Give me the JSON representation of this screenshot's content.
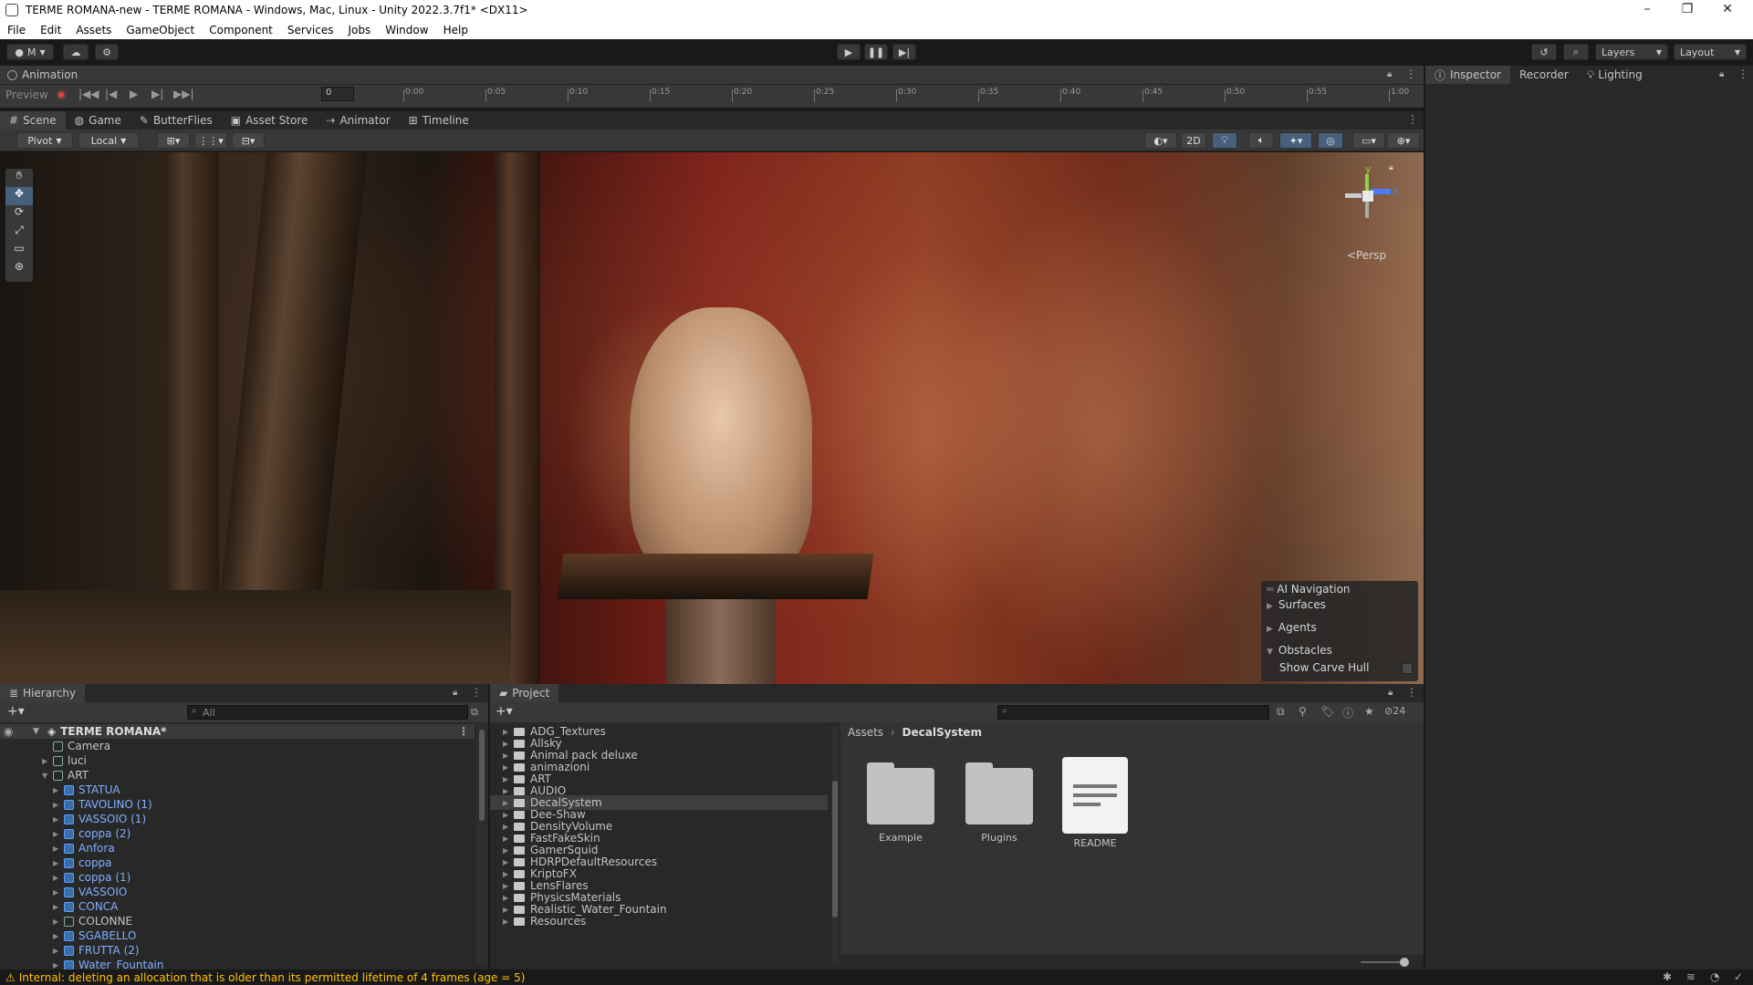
{
  "window": {
    "title": "TERME ROMANA-new - TERME ROMANA - Windows, Mac, Linux - Unity 2022.3.7f1* <DX11>"
  },
  "menu": [
    "File",
    "Edit",
    "Assets",
    "GameObject",
    "Component",
    "Services",
    "Jobs",
    "Window",
    "Help"
  ],
  "toolbar": {
    "account_label": "M",
    "layers_label": "Layers",
    "layout_label": "Layout"
  },
  "animation": {
    "tab_label": "Animation",
    "preview_label": "Preview",
    "frame_value": "0",
    "ticks": [
      "0:00",
      "0:05",
      "0:10",
      "0:15",
      "0:20",
      "0:25",
      "0:30",
      "0:35",
      "0:40",
      "0:45",
      "0:50",
      "0:55",
      "1:00"
    ]
  },
  "scene_tabs": [
    "Scene",
    "Game",
    "ButterFlies",
    "Asset Store",
    "Animator",
    "Timeline"
  ],
  "scene_tools": {
    "pivot_label": "Pivot",
    "local_label": "Local",
    "mode_2d_label": "2D",
    "persp_label": "<Persp"
  },
  "ai_navigation": {
    "title": "AI Navigation",
    "items": [
      "Surfaces",
      "Agents",
      "Obstacles"
    ],
    "option_label": "Show Carve Hull"
  },
  "hierarchy": {
    "tab_label": "Hierarchy",
    "search_placeholder": "All",
    "scene_name": "TERME ROMANA*",
    "rows": [
      {
        "label": "Camera",
        "indent": 1,
        "blue": false
      },
      {
        "label": "luci",
        "indent": 1,
        "blue": false
      },
      {
        "label": "ART",
        "indent": 1,
        "blue": false
      },
      {
        "label": "STATUA",
        "indent": 2,
        "blue": true
      },
      {
        "label": "TAVOLINO (1)",
        "indent": 2,
        "blue": true
      },
      {
        "label": "VASSOIO (1)",
        "indent": 2,
        "blue": true
      },
      {
        "label": "coppa (2)",
        "indent": 2,
        "blue": true
      },
      {
        "label": "Anfora",
        "indent": 2,
        "blue": true
      },
      {
        "label": "coppa",
        "indent": 2,
        "blue": true
      },
      {
        "label": "coppa (1)",
        "indent": 2,
        "blue": true
      },
      {
        "label": "VASSOIO",
        "indent": 2,
        "blue": true
      },
      {
        "label": "CONCA",
        "indent": 2,
        "blue": true
      },
      {
        "label": "COLONNE",
        "indent": 2,
        "blue": false
      },
      {
        "label": "SGABELLO",
        "indent": 2,
        "blue": true
      },
      {
        "label": "FRUTTA (2)",
        "indent": 2,
        "blue": true
      },
      {
        "label": "Water_Fountain",
        "indent": 2,
        "blue": true
      }
    ]
  },
  "project": {
    "tab_label": "Project",
    "hidden_count": "24",
    "folders": [
      "ADG_Textures",
      "Allsky",
      "Animal pack deluxe",
      "animazioni",
      "ART",
      "AUDIO",
      "DecalSystem",
      "Dee-Shaw",
      "DensityVolume",
      "FastFakeSkin",
      "GamerSquid",
      "HDRPDefaultResources",
      "KriptoFX",
      "LensFlares",
      "PhysicsMaterials",
      "Realistic_Water_Fountain",
      "Resources"
    ],
    "selected_folder": "DecalSystem",
    "breadcrumb": [
      "Assets",
      "DecalSystem"
    ],
    "assets": [
      {
        "name": "Example",
        "kind": "folder"
      },
      {
        "name": "Plugins",
        "kind": "folder"
      },
      {
        "name": "README",
        "kind": "file"
      }
    ]
  },
  "inspector_tabs": [
    "Inspector",
    "Recorder",
    "Lighting"
  ],
  "status": {
    "message": "Internal: deleting an allocation that is older than its permitted lifetime of 4 frames (age = 5)"
  }
}
